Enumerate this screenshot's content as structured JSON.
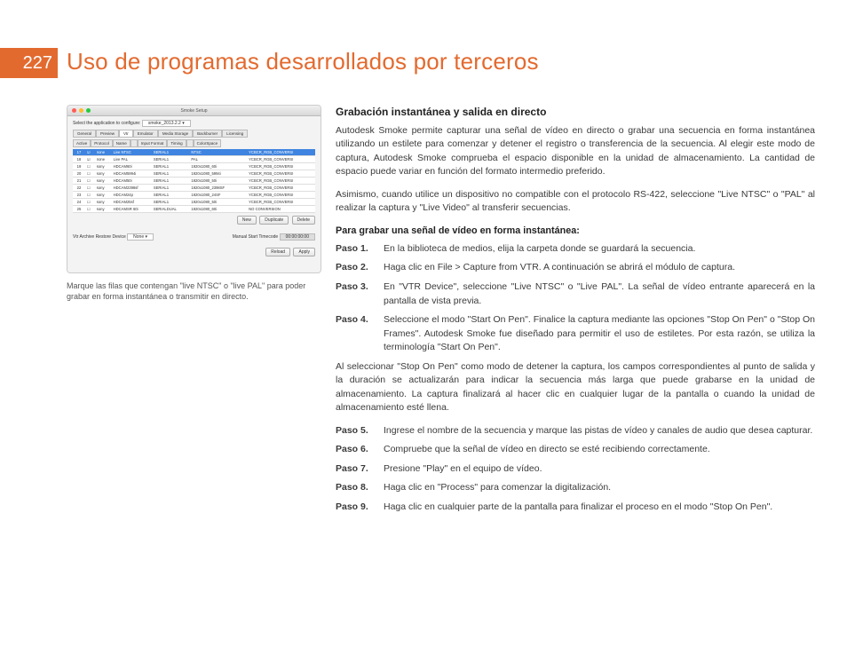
{
  "page_number": "227",
  "title": "Uso de programas desarrollados por terceros",
  "screenshot": {
    "window_title": "Smoke Setup",
    "select_label": "Select the application to configure:",
    "select_value": "smoke_2013.2.2",
    "tabs": [
      "General",
      "Preview",
      "Vtr",
      "Emulator",
      "Media Storage",
      "Backburner",
      "Licensing"
    ],
    "active_tab": "Vtr",
    "subtabs": [
      "Active",
      "Protocol",
      "Name",
      "",
      "Input Format",
      "Timing",
      "",
      "ColorSpace"
    ],
    "rows": [
      {
        "n": "17",
        "sel": true,
        "chk": true,
        "proto": "none",
        "name": "Live NTSC",
        "serial": "SERIAL1",
        "fmt": "NTSC",
        "timing": "",
        "cs": "YCBCR_RGB_CONVERSI"
      },
      {
        "n": "18",
        "sel": false,
        "chk": true,
        "proto": "none",
        "name": "Live PAL",
        "serial": "SERIAL1",
        "fmt": "PAL",
        "timing": "",
        "cs": "YCBCR_RGB_CONVERSI"
      },
      {
        "n": "19",
        "sel": false,
        "chk": false,
        "proto": "sony",
        "name": "HDCAM60i",
        "serial": "SERIAL1",
        "fmt": "1920x1080_60i",
        "timing": "",
        "cs": "YCBCR_RGB_CONVERSI"
      },
      {
        "n": "20",
        "sel": false,
        "chk": false,
        "proto": "sony",
        "name": "HDCAM5994i",
        "serial": "SERIAL1",
        "fmt": "1920x1080_5994i",
        "timing": "",
        "cs": "YCBCR_RGB_CONVERSI"
      },
      {
        "n": "21",
        "sel": false,
        "chk": false,
        "proto": "sony",
        "name": "HDCAM50i",
        "serial": "SERIAL1",
        "fmt": "1920x1080_50i",
        "timing": "",
        "cs": "YCBCR_RGB_CONVERSI"
      },
      {
        "n": "22",
        "sel": false,
        "chk": false,
        "proto": "sony",
        "name": "HDCAM2398sf",
        "serial": "SERIAL1",
        "fmt": "1920x1080_2398SF",
        "timing": "",
        "cs": "YCBCR_RGB_CONVERSI"
      },
      {
        "n": "23",
        "sel": false,
        "chk": false,
        "proto": "sony",
        "name": "HDCAM24p",
        "serial": "SERIAL1",
        "fmt": "1920x1080_24SF",
        "timing": "",
        "cs": "YCBCR_RGB_CONVERSI"
      },
      {
        "n": "24",
        "sel": false,
        "chk": false,
        "proto": "sony",
        "name": "HDCAM25sf",
        "serial": "SERIAL1",
        "fmt": "1920x1080_50i",
        "timing": "",
        "cs": "YCBCR_RGB_CONVERSI"
      },
      {
        "n": "25",
        "sel": false,
        "chk": false,
        "proto": "sony",
        "name": "HDCAMSR 60i",
        "serial": "SERIALDUAL",
        "fmt": "1920x1080_60i",
        "timing": "",
        "cs": "NO CONVERSION"
      }
    ],
    "btn_new": "New",
    "btn_duplicate": "Duplicate",
    "btn_delete": "Delete",
    "archive_label": "Vtr Archive Restore Device",
    "archive_value": "None",
    "timecode_label": "Manual Start Timecode",
    "timecode_value": "00:00:00:00",
    "btn_reload": "Reload",
    "btn_apply": "Apply"
  },
  "caption": "Marque las filas que contengan \"live NTSC\" o \"live PAL\" para poder grabar en forma instantánea o transmitir en directo.",
  "r": {
    "h2": "Grabación instantánea y salida en directo",
    "p1": "Autodesk Smoke permite capturar una señal de vídeo en directo o grabar una secuencia en forma instantánea utilizando un estilete para comenzar y detener el registro o transferencia de la secuencia. Al elegir este modo de captura, Autodesk Smoke comprueba el espacio disponible en la unidad de almacenamiento. La cantidad de espacio puede variar en función del formato intermedio preferido.",
    "p2": "Asimismo, cuando utilice un dispositivo no compatible con el protocolo RS-422, seleccione \"Live NTSC\" o \"PAL\" al realizar la captura y \"Live Video\" al transferir secuencias.",
    "sub": "Para grabar una señal de vídeo en forma instantánea:",
    "steps": [
      {
        "label": "Paso 1.",
        "text": "En la biblioteca de medios, elija la carpeta donde se guardará la secuencia."
      },
      {
        "label": "Paso 2.",
        "text": "Haga clic en File > Capture from VTR. A continuación se abrirá el módulo de captura."
      },
      {
        "label": "Paso 3.",
        "text": "En \"VTR Device\", seleccione \"Live NTSC\" o \"Live PAL\". La señal de vídeo entrante aparecerá en la pantalla de vista previa."
      },
      {
        "label": "Paso 4.",
        "text": "Seleccione el modo \"Start On Pen\". Finalice la captura mediante las opciones \"Stop On Pen\" o \"Stop On Frames\". Autodesk Smoke fue diseñado para permitir el uso de estiletes. Por esta razón, se utiliza la terminología \"Start On Pen\"."
      }
    ],
    "p3": "Al seleccionar \"Stop On Pen\" como modo de detener la captura, los campos correspondientes al punto de salida y la duración se actualizarán para indicar la secuencia más larga que puede grabarse en la unidad de almacenamiento. La captura finalizará al hacer clic en cualquier lugar de la pantalla o cuando la unidad de almacenamiento esté llena.",
    "steps2": [
      {
        "label": "Paso 5.",
        "text": "Ingrese el nombre de la secuencia y marque las pistas de vídeo y canales de audio que desea capturar."
      },
      {
        "label": "Paso 6.",
        "text": "Compruebe que la señal de vídeo en directo se esté recibiendo correctamente."
      },
      {
        "label": "Paso 7.",
        "text": "Presione \"Play\" en el equipo de vídeo."
      },
      {
        "label": "Paso 8.",
        "text": "Haga clic en \"Process\" para comenzar la digitalización."
      },
      {
        "label": "Paso 9.",
        "text": "Haga clic en cualquier parte de la pantalla para finalizar el proceso en el modo \"Stop On Pen\"."
      }
    ]
  }
}
